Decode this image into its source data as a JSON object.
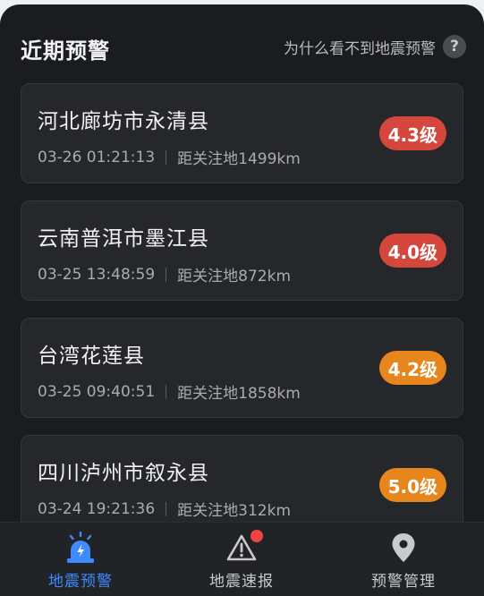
{
  "header": {
    "title": "近期预警",
    "help_text": "为什么看不到地震预警",
    "help_icon_glyph": "?"
  },
  "warnings": [
    {
      "place": "河北廊坊市永清县",
      "time": "03-26 01:21:13",
      "distance": "距关注地1499km",
      "magnitude": "4.3级",
      "color": "#d5463c"
    },
    {
      "place": "云南普洱市墨江县",
      "time": "03-25 13:48:59",
      "distance": "距关注地872km",
      "magnitude": "4.0级",
      "color": "#d5463c"
    },
    {
      "place": "台湾花莲县",
      "time": "03-25 09:40:51",
      "distance": "距关注地1858km",
      "magnitude": "4.2级",
      "color": "#e8861e"
    },
    {
      "place": "四川泸州市叙永县",
      "time": "03-24 19:21:36",
      "distance": "距关注地312km",
      "magnitude": "5.0级",
      "color": "#e8861e"
    }
  ],
  "tabs": [
    {
      "label": "地震预警",
      "icon": "alarm-siren-icon",
      "active": true
    },
    {
      "label": "地震速报",
      "icon": "warning-triangle-icon",
      "badge": true
    },
    {
      "label": "预警管理",
      "icon": "location-pin-icon"
    }
  ],
  "colors": {
    "accent": "#3d8bff",
    "background": "#1b1c1f",
    "card": "#26272b"
  }
}
